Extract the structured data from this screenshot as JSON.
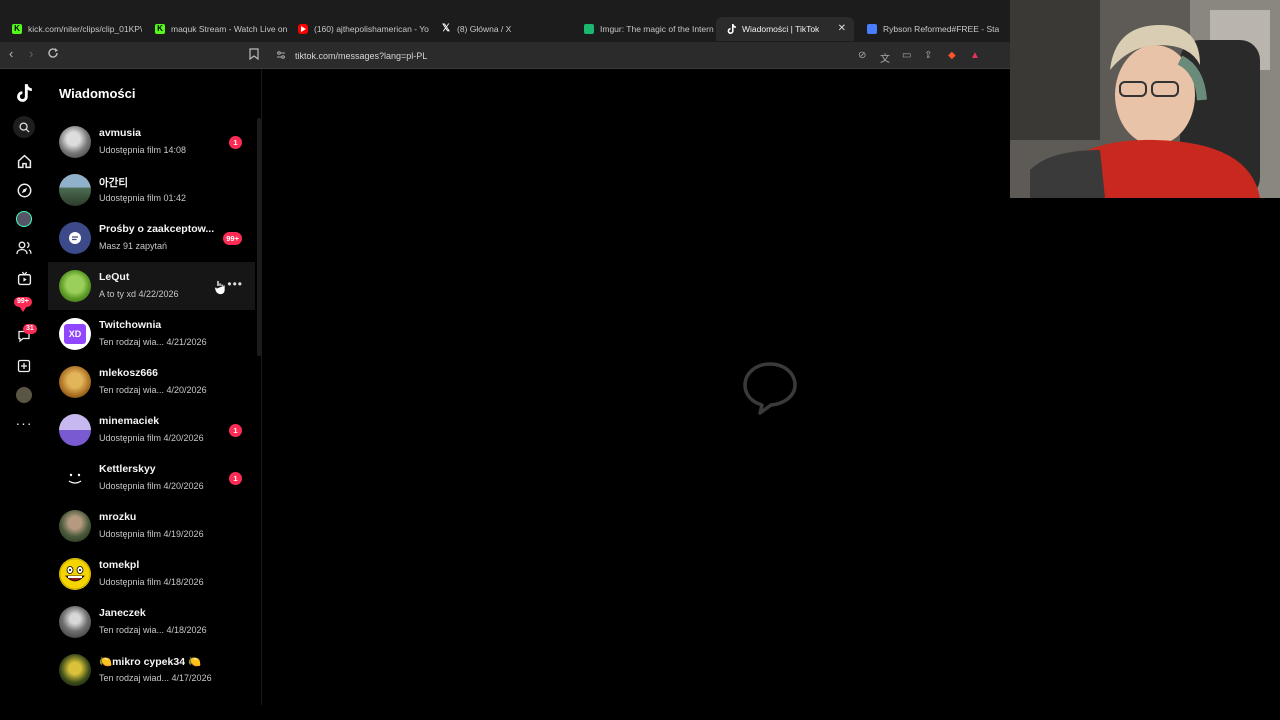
{
  "browser": {
    "tabs": [
      {
        "title": "kick.com/niter/clips/clip_01KP\\",
        "favicon": "kick-icon",
        "color": "#53fc18"
      },
      {
        "title": "maquk Stream - Watch Live on",
        "favicon": "kick-icon",
        "color": "#53fc18"
      },
      {
        "title": "(160) ajthepolishamerican - Yo",
        "favicon": "youtube-icon",
        "color": "#ff0000"
      },
      {
        "title": "(8) Główna / X",
        "favicon": "x-icon",
        "color": "#ffffff"
      },
      {
        "title": "Imgur: The magic of the Intern",
        "favicon": "imgur-icon",
        "color": "#1bb76e"
      },
      {
        "title": "Wiadomości | TikTok",
        "favicon": "tiktok-icon",
        "color": "#ffffff"
      },
      {
        "title": "Rybson Reformed#FREE - Staty",
        "favicon": "generic-site-icon",
        "color": "#4a7cff"
      }
    ],
    "active_tab_index": 5,
    "url": "tiktok.com/messages?lang=pl-PL"
  },
  "rail": {
    "badges": {
      "activity": "99+",
      "inbox": "31"
    }
  },
  "messages": {
    "title": "Wiadomości",
    "conversations": [
      {
        "name": "avmusia",
        "preview": "Udostępnia film 14:08",
        "badge": "1",
        "avatar_color": "#9a9a9a"
      },
      {
        "name": "아간티",
        "preview": "Udostępnia film 01:42",
        "badge": "",
        "avatar_color": "#5a7a6a"
      },
      {
        "name": "Prośby o zaakceptow...",
        "preview": "Masz 91 zapytań",
        "badge": "99+",
        "avatar_color": "#3d4a8a"
      },
      {
        "name": "LeQut",
        "preview": "A to ty xd 4/22/2026",
        "badge": "",
        "avatar_color": "#6aa82e"
      },
      {
        "name": "Twitchownia",
        "preview": "Ten rodzaj wia...     4/21/2026",
        "badge": "",
        "avatar_color": "#9146ff"
      },
      {
        "name": "mlekosz666",
        "preview": "Ten rodzaj wia...     4/20/2026",
        "badge": "",
        "avatar_color": "#c9922e"
      },
      {
        "name": "minemaciek",
        "preview": "Udostępnia film 4/20/2026",
        "badge": "1",
        "avatar_color": "#8a7ad8"
      },
      {
        "name": "Kettlerskyy",
        "preview": "Udostępnia film 4/20/2026",
        "badge": "1",
        "avatar_color": "#000000"
      },
      {
        "name": "mrozku",
        "preview": "Udostępnia film 4/19/2026",
        "badge": "",
        "avatar_color": "#4a5a3a"
      },
      {
        "name": "tomekpl",
        "preview": "Udostępnia film 4/18/2026",
        "badge": "",
        "avatar_color": "#f5d400"
      },
      {
        "name": "Janeczek",
        "preview": "Ten rodzaj wia...     4/18/2026",
        "badge": "",
        "avatar_color": "#6a6a6a"
      },
      {
        "name": "🍋mikro cypek34 🍋",
        "preview": "Ten rodzaj wiad...  4/17/2026",
        "badge": "",
        "avatar_color": "#2a3a1a"
      }
    ]
  },
  "colors": {
    "accent": "#fe2c55",
    "background": "#000000",
    "hover_row": "#161616"
  }
}
